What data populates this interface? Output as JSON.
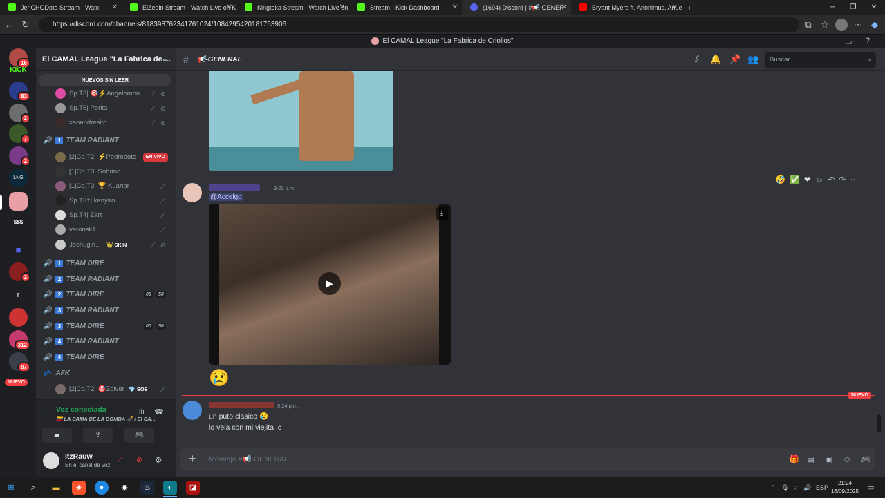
{
  "browser": {
    "tabs": [
      {
        "title": "JeriCHODota Stream - Watc",
        "favicon_color": "#53fc18"
      },
      {
        "title": "ElZeein Stream - Watch Live on K",
        "favicon_color": "#53fc18"
      },
      {
        "title": "Kingteka Stream - Watch Live on",
        "favicon_color": "#53fc18"
      },
      {
        "title": "Stream - Kick Dashboard",
        "favicon_color": "#53fc18"
      },
      {
        "title": "(1694) Discord | #📢-GENER",
        "favicon_color": "#5865f2"
      },
      {
        "title": "Bryant Myers ft. Anonimus, Anue",
        "favicon_color": "#ff0000"
      }
    ],
    "url": "https://discord.com/channels/818398762341761024/1084295420181753906"
  },
  "discord": {
    "window_title": "El CAMAL League \"La Fabrica de Criollos\"",
    "guild_badges": [
      "16",
      "83",
      "2",
      "7",
      "2",
      "2",
      "312",
      "87",
      "NUEVO"
    ],
    "guild_labels": [
      "$$$",
      "r"
    ],
    "server_name": "El CAMAL League \"La Fabrica de ...",
    "unread_label": "NUEVOS SIN LEER",
    "channels": [
      {
        "type": "user",
        "name": "Sp.T3| 🎯⚡Angelomon"
      },
      {
        "type": "user",
        "name": "Sp.T5| Porita"
      },
      {
        "type": "user",
        "name": "xaoandresito"
      },
      {
        "type": "voice",
        "num": "1",
        "name": "TEAM RADIANT"
      },
      {
        "type": "user",
        "name": "[2]Co.T2| ⚡Pedrodoto",
        "live": "EN VIVO"
      },
      {
        "type": "user",
        "name": "[1]Co.T3| Sobrino"
      },
      {
        "type": "user",
        "name": "[1]Co.T3| 🏆 Kuaлar"
      },
      {
        "type": "user",
        "name": "Sp.T3†| kanyiro"
      },
      {
        "type": "user",
        "name": "Sp.T4| Zart"
      },
      {
        "type": "user",
        "name": "varonsk1"
      },
      {
        "type": "user",
        "name": ".lechugin..",
        "tag": "👑 SKIN"
      },
      {
        "type": "voice",
        "num": "1",
        "name": "TEAM DIRE"
      },
      {
        "type": "voice",
        "num": "2",
        "name": "TEAM RADIANT"
      },
      {
        "type": "voice",
        "num": "2",
        "name": "TEAM DIRE",
        "c1": "00",
        "c2": "50"
      },
      {
        "type": "voice",
        "num": "3",
        "name": "TEAM RADIANT"
      },
      {
        "type": "voice",
        "num": "3",
        "name": "TEAM DIRE",
        "c1": "00",
        "c2": "50"
      },
      {
        "type": "voice",
        "num": "4",
        "name": "TEAM RADIANT"
      },
      {
        "type": "voice",
        "num": "4",
        "name": "TEAM DIRE"
      },
      {
        "type": "voice",
        "num": "",
        "name": "AFK"
      },
      {
        "type": "user",
        "name": "[2]Co.T2| 🎯Zolver",
        "tag": "💎 SOS"
      }
    ],
    "voice": {
      "status": "Voz conectada",
      "channel": "🇻🇪 LA CAMA DE LA BOMBA 💣 / El CA..."
    },
    "user": {
      "name": "ItzRauw",
      "status": "En el canal de voz"
    },
    "channel_header": "📢-GENERAL",
    "search_placeholder": "Buscar",
    "messages": [
      {
        "time": "9:23 p.m.",
        "mention": "@Accelgd"
      },
      {
        "time": "9:24 p.m.",
        "lines": [
          "un puto clasico 😢",
          "lo veia con mi viejita :c"
        ]
      }
    ],
    "new_label": "NUEVO",
    "composer_placeholder": "Mensaje #📢-GENERAL"
  },
  "taskbar": {
    "lang": "ESP",
    "time": "21:24",
    "date": "16/09/2025"
  }
}
